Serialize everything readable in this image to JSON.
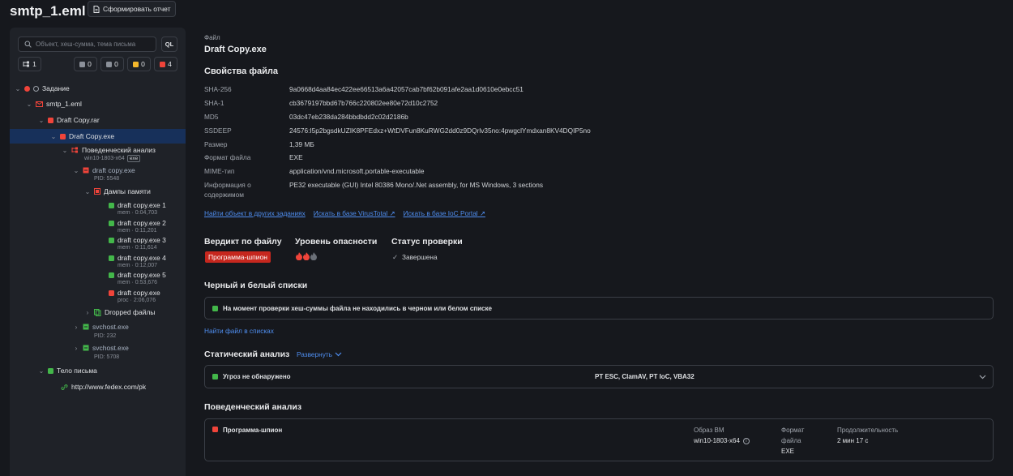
{
  "header": {
    "title": "smtp_1.eml",
    "report_label": "Сформировать отчет"
  },
  "sidebar": {
    "search_placeholder": "Объект, хеш-сумма, тема письма",
    "ql_label": "QL",
    "chips": {
      "tree": "1",
      "grey": "0",
      "flag": "0",
      "yellow": "0",
      "red": "4"
    },
    "tree": {
      "task": "Задание",
      "eml": "smtp_1.eml",
      "rar": "Draft Copy.rar",
      "exe": "Draft Copy.exe",
      "behav": "Поведенческий анализ",
      "behav_sub": "win10-1803-x64",
      "behav_tag": "exe",
      "proc1": "draft copy.exe",
      "proc1_pid": "PID: 5548",
      "dumps": "Дампы памяти",
      "d1": "draft copy.exe 1",
      "d1s": "mem · 0:04,703",
      "d2": "draft copy.exe 2",
      "d2s": "mem · 0:11,201",
      "d3": "draft copy.exe 3",
      "d3s": "mem · 0:11,614",
      "d4": "draft copy.exe 4",
      "d4s": "mem · 0:12,007",
      "d5": "draft copy.exe 5",
      "d5s": "mem · 0:53,676",
      "d6": "draft copy.exe",
      "d6s": "proc · 2:06,076",
      "dropped": "Dropped файлы",
      "svc1": "svchost.exe",
      "svc1_pid": "PID: 232",
      "svc2": "svchost.exe",
      "svc2_pid": "PID: 5708",
      "body": "Тело письма",
      "url": "http://www.fedex.com/pk"
    }
  },
  "main": {
    "file_label": "Файл",
    "file_name": "Draft Copy.exe",
    "props_title": "Свойства файла",
    "props": [
      {
        "k": "SHA-256",
        "v": "9a0668d4aa84ec422ee66513a6a42057cab7bf62b091afe2aa1d0610e0ebcc51"
      },
      {
        "k": "SHA-1",
        "v": "cb3679197bbd67b766c220802ee80e72d10c2752"
      },
      {
        "k": "MD5",
        "v": "03dc47eb238da284bbdbdd2c02d2186b"
      },
      {
        "k": "SSDEEP",
        "v": "24576:I5p2bgsdkUZIK8PFEdxz+WtDVFun8KuRWG2dd0z9DQrlv35no:4pwgclYmdxan8KV4DQIP5no"
      },
      {
        "k": "Размер",
        "v": "1,39 МБ"
      },
      {
        "k": "Формат файла",
        "v": "EXE"
      },
      {
        "k": "MIME-тип",
        "v": "application/vnd.microsoft.portable-executable"
      },
      {
        "k": "Информация о",
        "v": "PE32 executable (GUI) Intel 80386 Mono/.Net assembly, for MS Windows, 3 sections",
        "k2": "содержимом"
      }
    ],
    "links": {
      "other": "Найти объект в других заданиях",
      "vt": "Искать в базе VirusTotal",
      "ioc": "Искать в базе IoC Portal"
    },
    "verdict": {
      "title": "Вердикт по файлу",
      "badge": "Программа-шпион",
      "danger_title": "Уровень опасности",
      "status_title": "Статус проверки",
      "status": "Завершена"
    },
    "lists": {
      "title": "Черный и белый списки",
      "text": "На момент проверки хеш-суммы файла не находились в черном или белом списке",
      "link": "Найти файл в списках"
    },
    "static": {
      "title": "Статический анализ",
      "expand": "Развернуть",
      "result": "Угроз не обнаружено",
      "engines": "PT ESC, ClamAV, PT IoC, VBA32"
    },
    "behav": {
      "title": "Поведенческий анализ",
      "verdict": "Программа-шпион",
      "image_label": "Образ ВМ",
      "image": "win10-1803-x64",
      "fmt_label1": "Формат",
      "fmt_label2": "файла",
      "fmt": "EXE",
      "dur_label": "Продолжительность",
      "dur": "2 мин 17 с"
    }
  }
}
